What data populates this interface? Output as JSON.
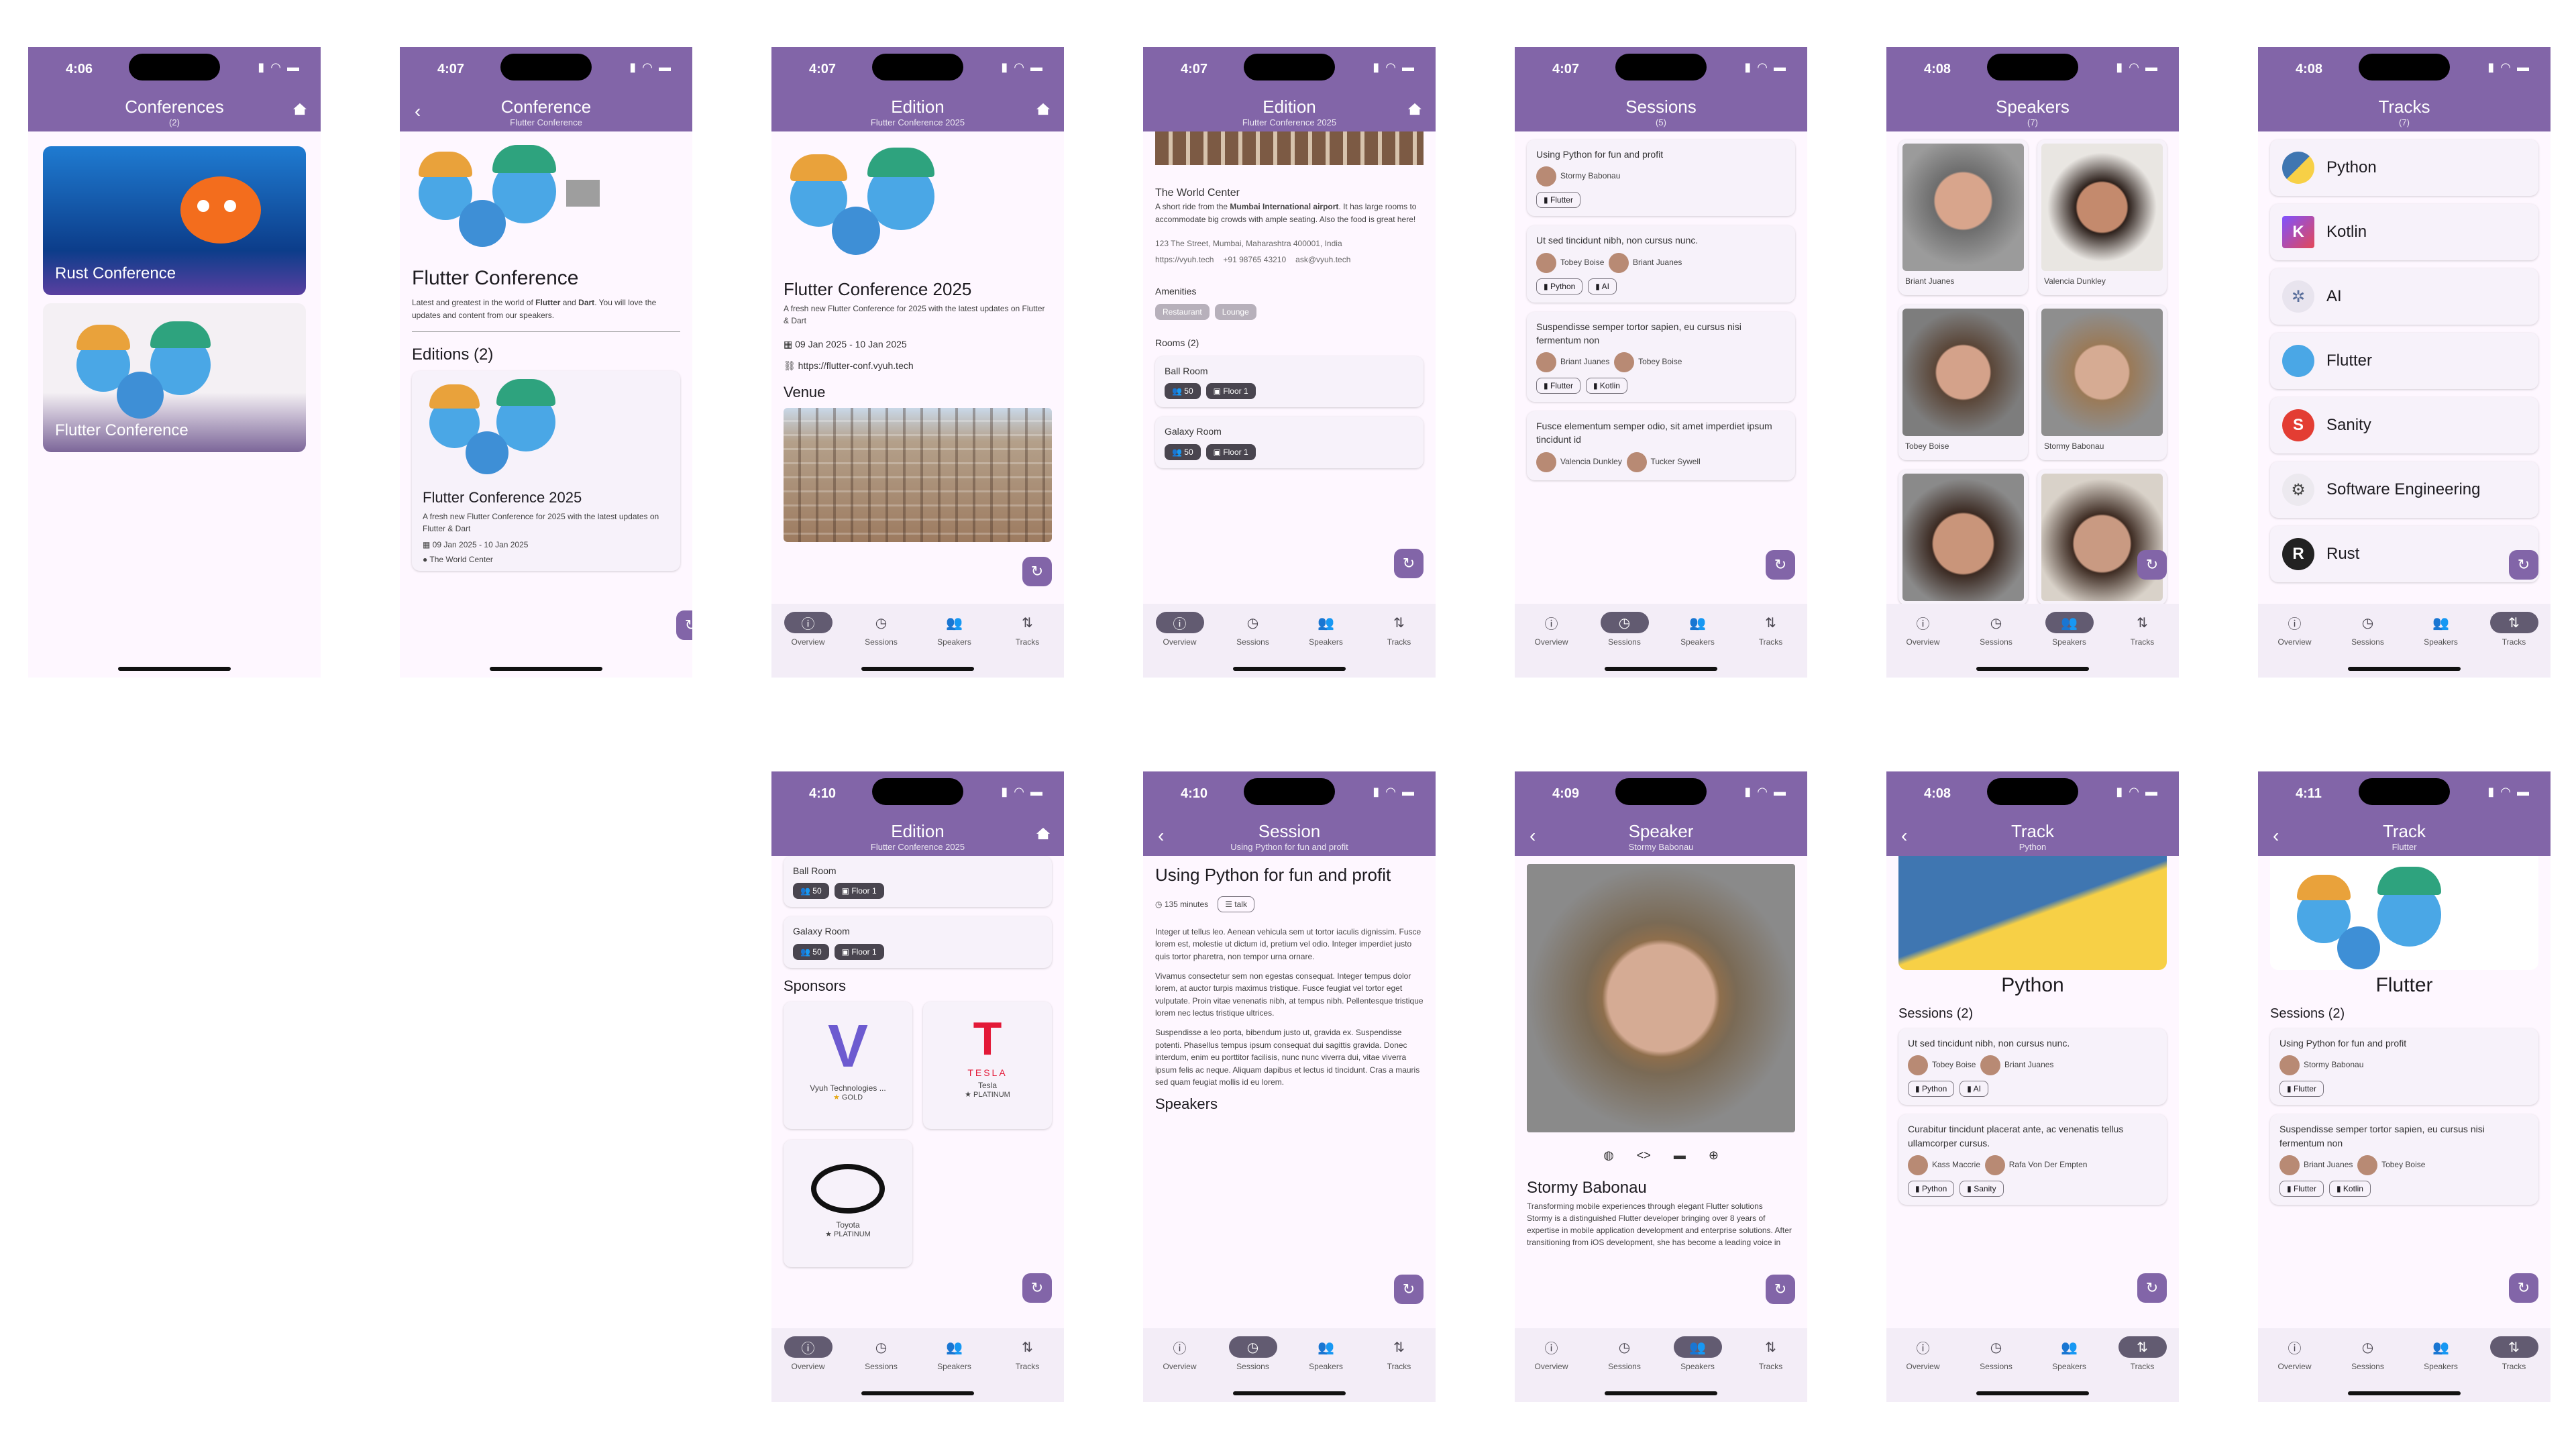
{
  "colors": {
    "primary": "#8265a8",
    "surface": "#fef7ff",
    "card": "#f7f2fa",
    "navActive": "#625b71"
  },
  "nav": [
    "Overview",
    "Sessions",
    "Speakers",
    "Tracks"
  ],
  "s1": {
    "time": "4:06",
    "title": "Conferences",
    "subtitle": "(2)",
    "items": [
      "Rust Conference",
      "Flutter Conference"
    ]
  },
  "s2": {
    "time": "4:07",
    "title": "Conference",
    "subtitle": "Flutter Conference",
    "name": "Flutter Conference",
    "desc_a": "Latest and greatest in the world of ",
    "flutter": "Flutter",
    "desc_and": " and ",
    "dart": "Dart",
    "desc_b": ". You will love the updates and content from our speakers.",
    "editions": "Editions (2)",
    "edition_title": "Flutter Conference 2025",
    "edition_desc": "A fresh new Flutter Conference for 2025 with the latest updates on Flutter & Dart",
    "edition_dates": "09 Jan 2025 - 10 Jan 2025",
    "edition_venue": "The World Center"
  },
  "s3": {
    "time": "4:07",
    "title": "Edition",
    "subtitle": "Flutter Conference 2025",
    "name": "Flutter Conference 2025",
    "desc": "A fresh new Flutter Conference for 2025 with the latest updates on Flutter & Dart",
    "dates": "09 Jan 2025 - 10 Jan 2025",
    "url": "https://flutter-conf.vyuh.tech",
    "venue": "Venue"
  },
  "s4": {
    "time": "4:07",
    "title": "Edition",
    "subtitle": "Flutter Conference 2025",
    "venue_name": "The World Center",
    "venue_a": "A short ride from the ",
    "venue_bold": "Mumbai International airport",
    "venue_b": ". It has large rooms to accommodate big crowds with ample seating. Also the food is great here!",
    "address": "123 The Street, Mumbai, Maharashtra 400001, India",
    "web": "https://vyuh.tech",
    "phone": "+91 98765 43210",
    "email": "ask@vyuh.tech",
    "amenities": "Amenities",
    "amenity1": "Restaurant",
    "amenity2": "Lounge",
    "rooms": "Rooms (2)",
    "room1": "Ball Room",
    "room2": "Galaxy Room",
    "capacity": "50",
    "floor": "Floor 1"
  },
  "s5": {
    "time": "4:07",
    "title": "Sessions",
    "subtitle": "(5)",
    "sessions": [
      {
        "title": "Using Python for fun and profit",
        "sp1": "Stormy Babonau",
        "sp2": "",
        "t1": "Flutter",
        "t2": ""
      },
      {
        "title": "Ut sed tincidunt nibh, non cursus nunc.",
        "sp1": "Tobey Boise",
        "sp2": "Briant Juanes",
        "t1": "Python",
        "t2": "AI"
      },
      {
        "title": "Suspendisse semper tortor sapien, eu cursus nisi fermentum non",
        "sp1": "Briant Juanes",
        "sp2": "Tobey Boise",
        "t1": "Flutter",
        "t2": "Kotlin"
      },
      {
        "title": "Fusce elementum semper odio, sit amet imperdiet ipsum tincidunt id",
        "sp1": "Valencia Dunkley",
        "sp2": "Tucker Sywell",
        "t1": "",
        "t2": ""
      }
    ]
  },
  "s6": {
    "time": "4:08",
    "title": "Speakers",
    "subtitle": "(7)",
    "names": [
      "Briant Juanes",
      "Valencia Dunkley",
      "Tobey Boise",
      "Stormy Babonau"
    ]
  },
  "s7": {
    "time": "4:08",
    "title": "Tracks",
    "subtitle": "(7)",
    "tracks": [
      "Python",
      "Kotlin",
      "AI",
      "Flutter",
      "Sanity",
      "Software Engineering",
      "Rust"
    ]
  },
  "s8": {
    "time": "4:10",
    "title": "Edition",
    "subtitle": "Flutter Conference 2025",
    "room1": "Ball Room",
    "room2": "Galaxy Room",
    "capacity": "50",
    "floor": "Floor 1",
    "sponsors": "Sponsors",
    "sp1": "Vyuh Technologies ...",
    "sp1tier": "GOLD",
    "sp2": "Tesla",
    "sp2tier": "PLATINUM",
    "sp3": "Toyota",
    "sp3tier": "PLATINUM",
    "tesla_word": "TESLA"
  },
  "s9": {
    "time": "4:10",
    "title": "Session",
    "subtitle": "Using Python for fun and profit",
    "heading": "Using Python for fun and profit",
    "duration": "135 minutes",
    "type": "talk",
    "p1": "Integer ut tellus leo. Aenean vehicula sem ut tortor iaculis dignissim. Fusce lorem est, molestie ut dictum id, pretium vel odio. Integer imperdiet justo quis tortor pharetra, non tempor urna ornare.",
    "p2": "Vivamus consectetur sem non egestas consequat. Integer tempus dolor lorem, at auctor turpis maximus tristique. Fusce feugiat vel tortor eget vulputate. Proin vitae venenatis nibh, at tempus nibh. Pellentesque tristique lorem nec lectus tristique ultrices.",
    "p3": "Suspendisse a leo porta, bibendum justo ut, gravida ex. Suspendisse potenti. Phasellus tempus ipsum consequat dui sagittis gravida. Donec interdum, enim eu porttitor facilisis, nunc nunc viverra dui, vitae viverra ipsum felis ac neque. Aliquam dapibus et lectus id tincidunt. Cras a mauris sed quam feugiat mollis id eu lorem.",
    "speakers": "Speakers"
  },
  "s10": {
    "time": "4:09",
    "title": "Speaker",
    "subtitle": "Stormy Babonau",
    "name": "Stormy Babonau",
    "tagline": "Transforming mobile experiences through elegant Flutter solutions",
    "bio": "Stormy is a distinguished Flutter developer bringing over 8 years of expertise in mobile application development and enterprise solutions. After transitioning from iOS development, she has become a leading voice in"
  },
  "s11": {
    "time": "4:08",
    "title": "Track",
    "subtitle": "Python",
    "name": "Python",
    "sessions": "Sessions (2)",
    "c1": {
      "title": "Ut sed tincidunt nibh, non cursus nunc.",
      "sp1": "Tobey Boise",
      "sp2": "Briant Juanes",
      "t1": "Python",
      "t2": "AI"
    },
    "c2": {
      "title": "Curabitur tincidunt placerat ante, ac venenatis tellus ullamcorper cursus.",
      "sp1": "Kass Maccrie",
      "sp2": "Rafa Von Der Empten",
      "t1": "Python",
      "t2": "Sanity"
    }
  },
  "s12": {
    "time": "4:11",
    "title": "Track",
    "subtitle": "Flutter",
    "name": "Flutter",
    "sessions": "Sessions (2)",
    "c1": {
      "title": "Using Python for fun and profit",
      "sp1": "Stormy Babonau",
      "t1": "Flutter"
    },
    "c2": {
      "title": "Suspendisse semper tortor sapien, eu cursus nisi fermentum non",
      "sp1": "Briant Juanes",
      "sp2": "Tobey Boise",
      "t1": "Flutter",
      "t2": "Kotlin"
    }
  }
}
